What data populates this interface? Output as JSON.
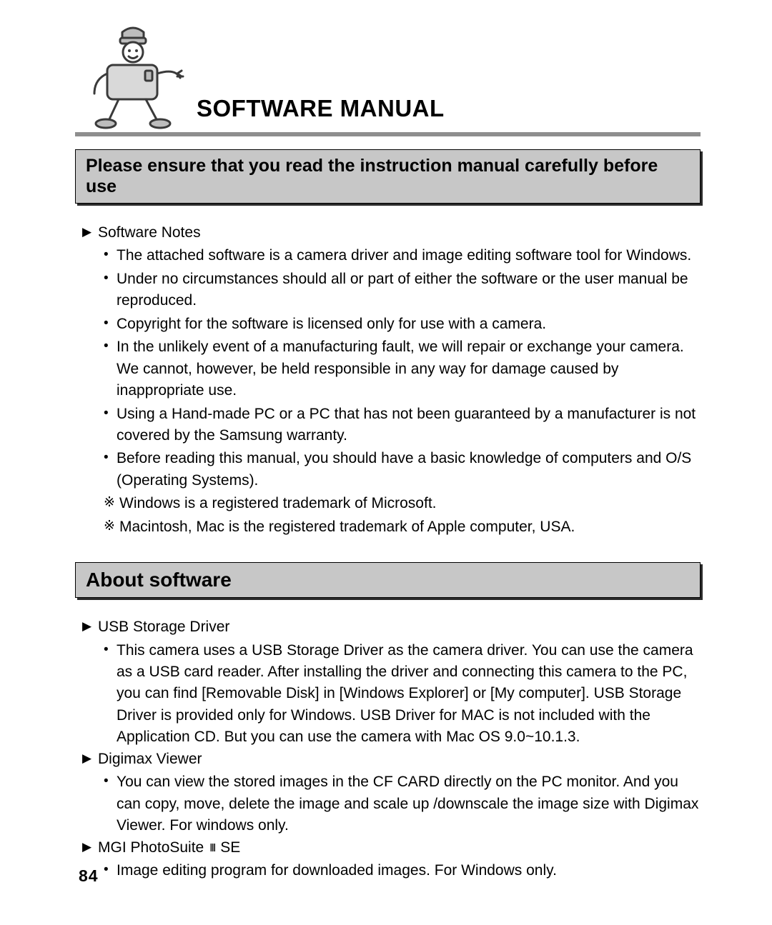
{
  "page_number": "84",
  "title": "SOFTWARE MANUAL",
  "banner": "Please ensure that you read the instruction manual carefully before use",
  "section1": {
    "heading": "Software Notes",
    "bullets": [
      "The attached software is a camera driver and image editing software tool for Windows.",
      "Under no circumstances should all or part of either the software or the user manual be reproduced.",
      "Copyright for the software is licensed only for use with a camera.",
      "In the unlikely event of a manufacturing fault, we will repair or exchange your camera. We cannot, however, be held responsible in any way for damage caused by inappropriate use.",
      "Using a Hand-made PC or a PC that has not been guaranteed by a manufacturer is not covered by the Samsung warranty.",
      "Before reading this manual, you should have a basic knowledge of computers and O/S (Operating Systems)."
    ],
    "notes": [
      "Windows is a registered trademark of Microsoft.",
      "Macintosh, Mac is the registered trademark of Apple computer, USA."
    ]
  },
  "section2": {
    "title": "About software",
    "items": [
      {
        "heading": "USB Storage Driver",
        "body": "This camera uses a USB Storage Driver as the camera driver. You can use the camera as a USB card reader. After installing the driver and connecting this camera to the PC, you can find [Removable Disk] in [Windows Explorer] or [My computer]. USB Storage Driver is provided only for Windows. USB Driver for MAC is not included with the Application CD. But you can use the camera with Mac OS 9.0~10.1.3."
      },
      {
        "heading": "Digimax Viewer",
        "body": "You can view the stored images in the CF CARD directly on the PC monitor. And you can copy, move, delete the image and scale up /downscale the image size with Digimax Viewer. For windows only."
      },
      {
        "heading_pre": "MGI PhotoSuite ",
        "heading_roman": "III",
        "heading_post": " SE",
        "body": "Image editing program for downloaded images. For Windows only."
      }
    ]
  }
}
